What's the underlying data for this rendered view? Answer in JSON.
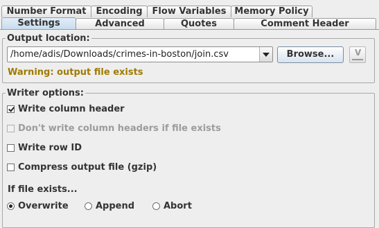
{
  "tabs": {
    "back_row": [
      "Number Format",
      "Encoding",
      "Flow Variables",
      "Memory Policy"
    ],
    "front_row": [
      "Settings",
      "Advanced",
      "Quotes",
      "Comment Header"
    ],
    "selected": "Settings"
  },
  "output_location": {
    "legend": "Output location:",
    "path_value": "/home/adis/Downloads/crimes-in-boston/join.csv",
    "browse_label": "Browse...",
    "flow_variable_icon": "V",
    "warning": "Warning: output file exists"
  },
  "writer_options": {
    "legend": "Writer options:",
    "write_column_header": {
      "label": "Write column header",
      "checked": true,
      "enabled": true
    },
    "dont_write_headers": {
      "label": "Don't write column headers if file exists",
      "checked": false,
      "enabled": false
    },
    "write_row_id": {
      "label": "Write row ID",
      "checked": false,
      "enabled": true
    },
    "compress": {
      "label": "Compress output file (gzip)",
      "checked": false,
      "enabled": true
    }
  },
  "if_file_exists": {
    "label": "If file exists...",
    "options": [
      "Overwrite",
      "Append",
      "Abort"
    ],
    "selected": "Overwrite"
  },
  "colors": {
    "warning": "#a07a00",
    "tab_selected": "#c6dbee",
    "background": "#eeeeee"
  }
}
